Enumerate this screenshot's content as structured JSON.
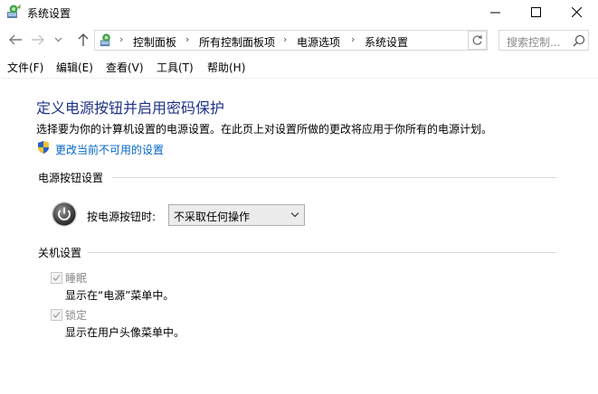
{
  "window": {
    "title": "系统设置"
  },
  "address_bar": {
    "crumbs": [
      "控制面板",
      "所有控制面板项",
      "电源选项",
      "系统设置"
    ],
    "separator": "›"
  },
  "search": {
    "placeholder": "搜索控制..."
  },
  "menu": [
    "文件(F)",
    "编辑(E)",
    "查看(V)",
    "工具(T)",
    "帮助(H)"
  ],
  "main": {
    "title": "定义电源按钮并启用密码保护",
    "description": "选择要为你的计算机设置的电源设置。在此页上对设置所做的更改将应用于你所有的电源计划。",
    "change_link": "更改当前不可用的设置",
    "power_section": {
      "title": "电源按钮设置",
      "power_label": "按电源按钮时:",
      "power_value": "不采取任何操作"
    },
    "shutdown_section": {
      "title": "关机设置",
      "options": [
        {
          "label": "睡眠",
          "description": "显示在“电源”菜单中。",
          "checked": true,
          "disabled": true
        },
        {
          "label": "锁定",
          "description": "显示在用户头像菜单中。",
          "checked": true,
          "disabled": true
        }
      ]
    }
  },
  "icons": {
    "app": "control-panel-icon",
    "back": "back-arrow-icon",
    "forward": "forward-arrow-icon",
    "recent": "chevron-down-icon",
    "up": "up-arrow-icon",
    "refresh": "refresh-icon",
    "search": "search-icon",
    "shield": "uac-shield-icon",
    "power": "power-button-icon"
  },
  "colors": {
    "title": "#1e3287",
    "link": "#0066cc",
    "disabled_text": "#8a8a8a"
  }
}
